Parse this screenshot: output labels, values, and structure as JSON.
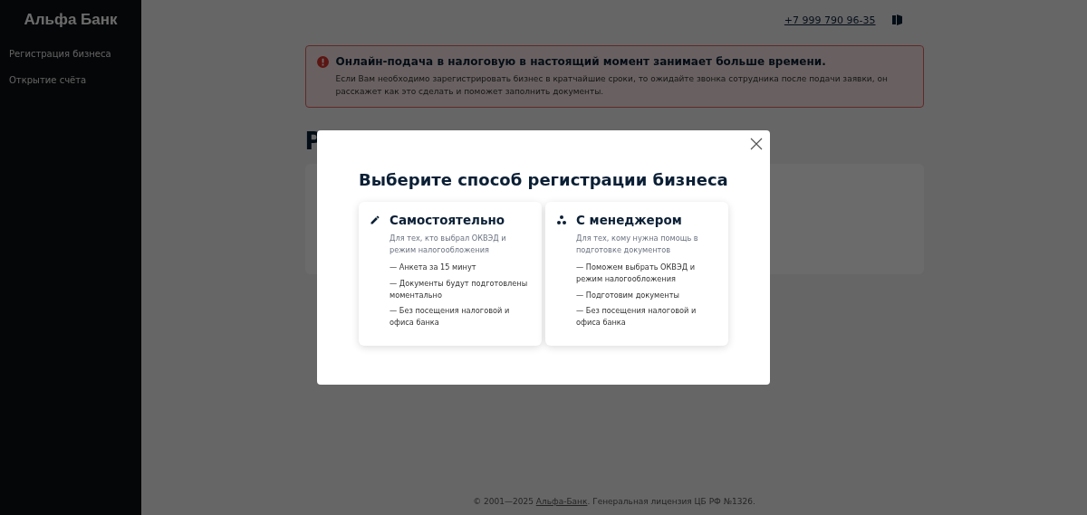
{
  "sidebar": {
    "logo": "Альфа Банк",
    "items": [
      {
        "label": "Регистрация бизнеса"
      },
      {
        "label": "Открытие счёта"
      }
    ]
  },
  "header": {
    "phone": "+7 999 790 96-35"
  },
  "alert": {
    "title": "Онлайн-подача в налоговую в настоящий момент занимает больше времени.",
    "text": "Если Вам необходимо зарегистрировать бизнес в кратчайшие сроки, то ожидайте звонка сотрудника после подачи заявки, он расскажет как это сделать и поможет заполнить документы."
  },
  "page": {
    "heading": "Р"
  },
  "footer": {
    "prefix": "© 2001—2025 ",
    "link": "Альфа-Банк",
    "suffix": ". Генеральная лицензия ЦБ РФ №1326."
  },
  "modal": {
    "title": "Выберите способ регистрации бизнеса",
    "options": [
      {
        "kind": "self",
        "title": "Самостоятельно",
        "subtitle": "Для тех, кто выбрал ОКВЭД и режим налогообложения",
        "points": [
          "— Анкета за 15 минут",
          "— Документы будут подготовлены моментально",
          "— Без посещения налоговой и офиса банка"
        ]
      },
      {
        "kind": "manager",
        "title": "С менеджером",
        "subtitle": "Для тех, кому нужна помощь в подготовке документов",
        "points": [
          "— Поможем выбрать ОКВЭД и режим налогообложения",
          "— Подготовим документы",
          "— Без посещения налоговой и офиса банка"
        ]
      }
    ]
  }
}
